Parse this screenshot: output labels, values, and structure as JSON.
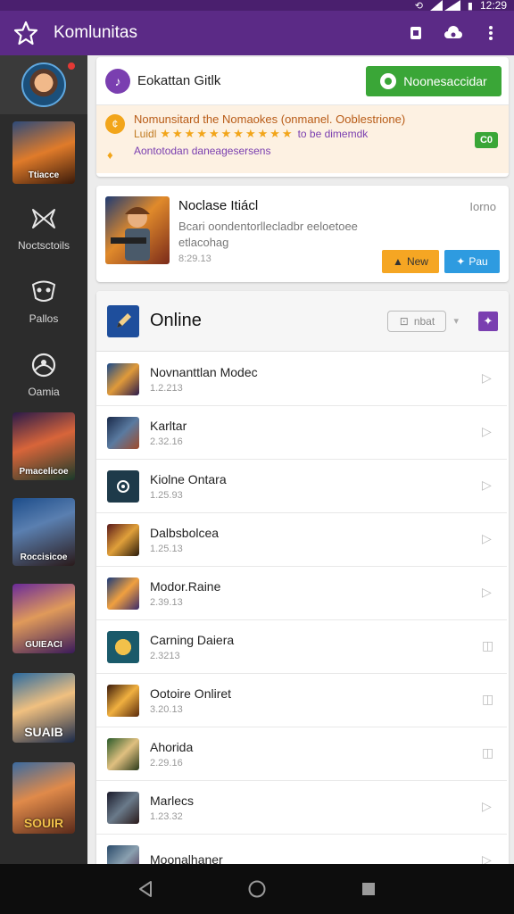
{
  "status": {
    "time": "12:29"
  },
  "appbar": {
    "title": "Komlunitas",
    "logo_icon": "star-icon",
    "actions": [
      "album-icon",
      "cloud-icon",
      "more-vert-icon"
    ]
  },
  "sidebar": {
    "games_top": [
      {
        "label": "Ttiacce"
      }
    ],
    "nav": [
      {
        "label": "Noctsctoils",
        "icon": "wings-icon"
      },
      {
        "label": "Pallos",
        "icon": "mask-icon"
      },
      {
        "label": "Oamia",
        "icon": "globe-icon"
      }
    ],
    "games": [
      {
        "label": "Pmacelicoe"
      },
      {
        "label": "Roccisicoe"
      },
      {
        "label": "GUIEACI"
      },
      {
        "label": "SUAIB"
      },
      {
        "label": "SOUIR"
      }
    ]
  },
  "notice": {
    "title": "Eokattan Gitlk",
    "button": "Noonesaccidar",
    "promo_line1": "Nomunsitard the Nomaokes (onmanel. Ooblestrione)",
    "promo_line2_prefix": "Luidl",
    "promo_stars": "★★★★★★★★★★★",
    "promo_line2_link": "to be dimemdk",
    "promo_line3": "Aontotodan daneagesersens",
    "promo_badge": "C0"
  },
  "featured": {
    "title": "Noclase Itiácl",
    "more": "Iorno",
    "desc": "Bcari oondentorllecladbr eeloetoee etlacohag",
    "date": "8:29.13",
    "btn_new": "New",
    "btn_play": "Pau"
  },
  "online": {
    "title": "Online",
    "filter": "nbat",
    "rows": [
      {
        "name": "Novnanttlan Modec",
        "date": "1.2.213"
      },
      {
        "name": "Karltar",
        "date": "2.32.16"
      },
      {
        "name": "Kiolne Ontara",
        "date": "1.25.93"
      },
      {
        "name": "Dalbsbolcea",
        "date": "1.25.13"
      },
      {
        "name": "Modor.Raine",
        "date": "2.39.13"
      },
      {
        "name": "Carning Daiera",
        "date": "2.3213"
      },
      {
        "name": "Ootoire Onliret",
        "date": "3.20.13"
      },
      {
        "name": "Ahorida",
        "date": "2.29.16"
      },
      {
        "name": "Marlecs",
        "date": "1.23.32"
      },
      {
        "name": "Moonalhaner",
        "date": ""
      }
    ]
  },
  "colors": {
    "appbar": "#5b2a86",
    "accent": "#7a3fb0",
    "green": "#3aa637"
  }
}
